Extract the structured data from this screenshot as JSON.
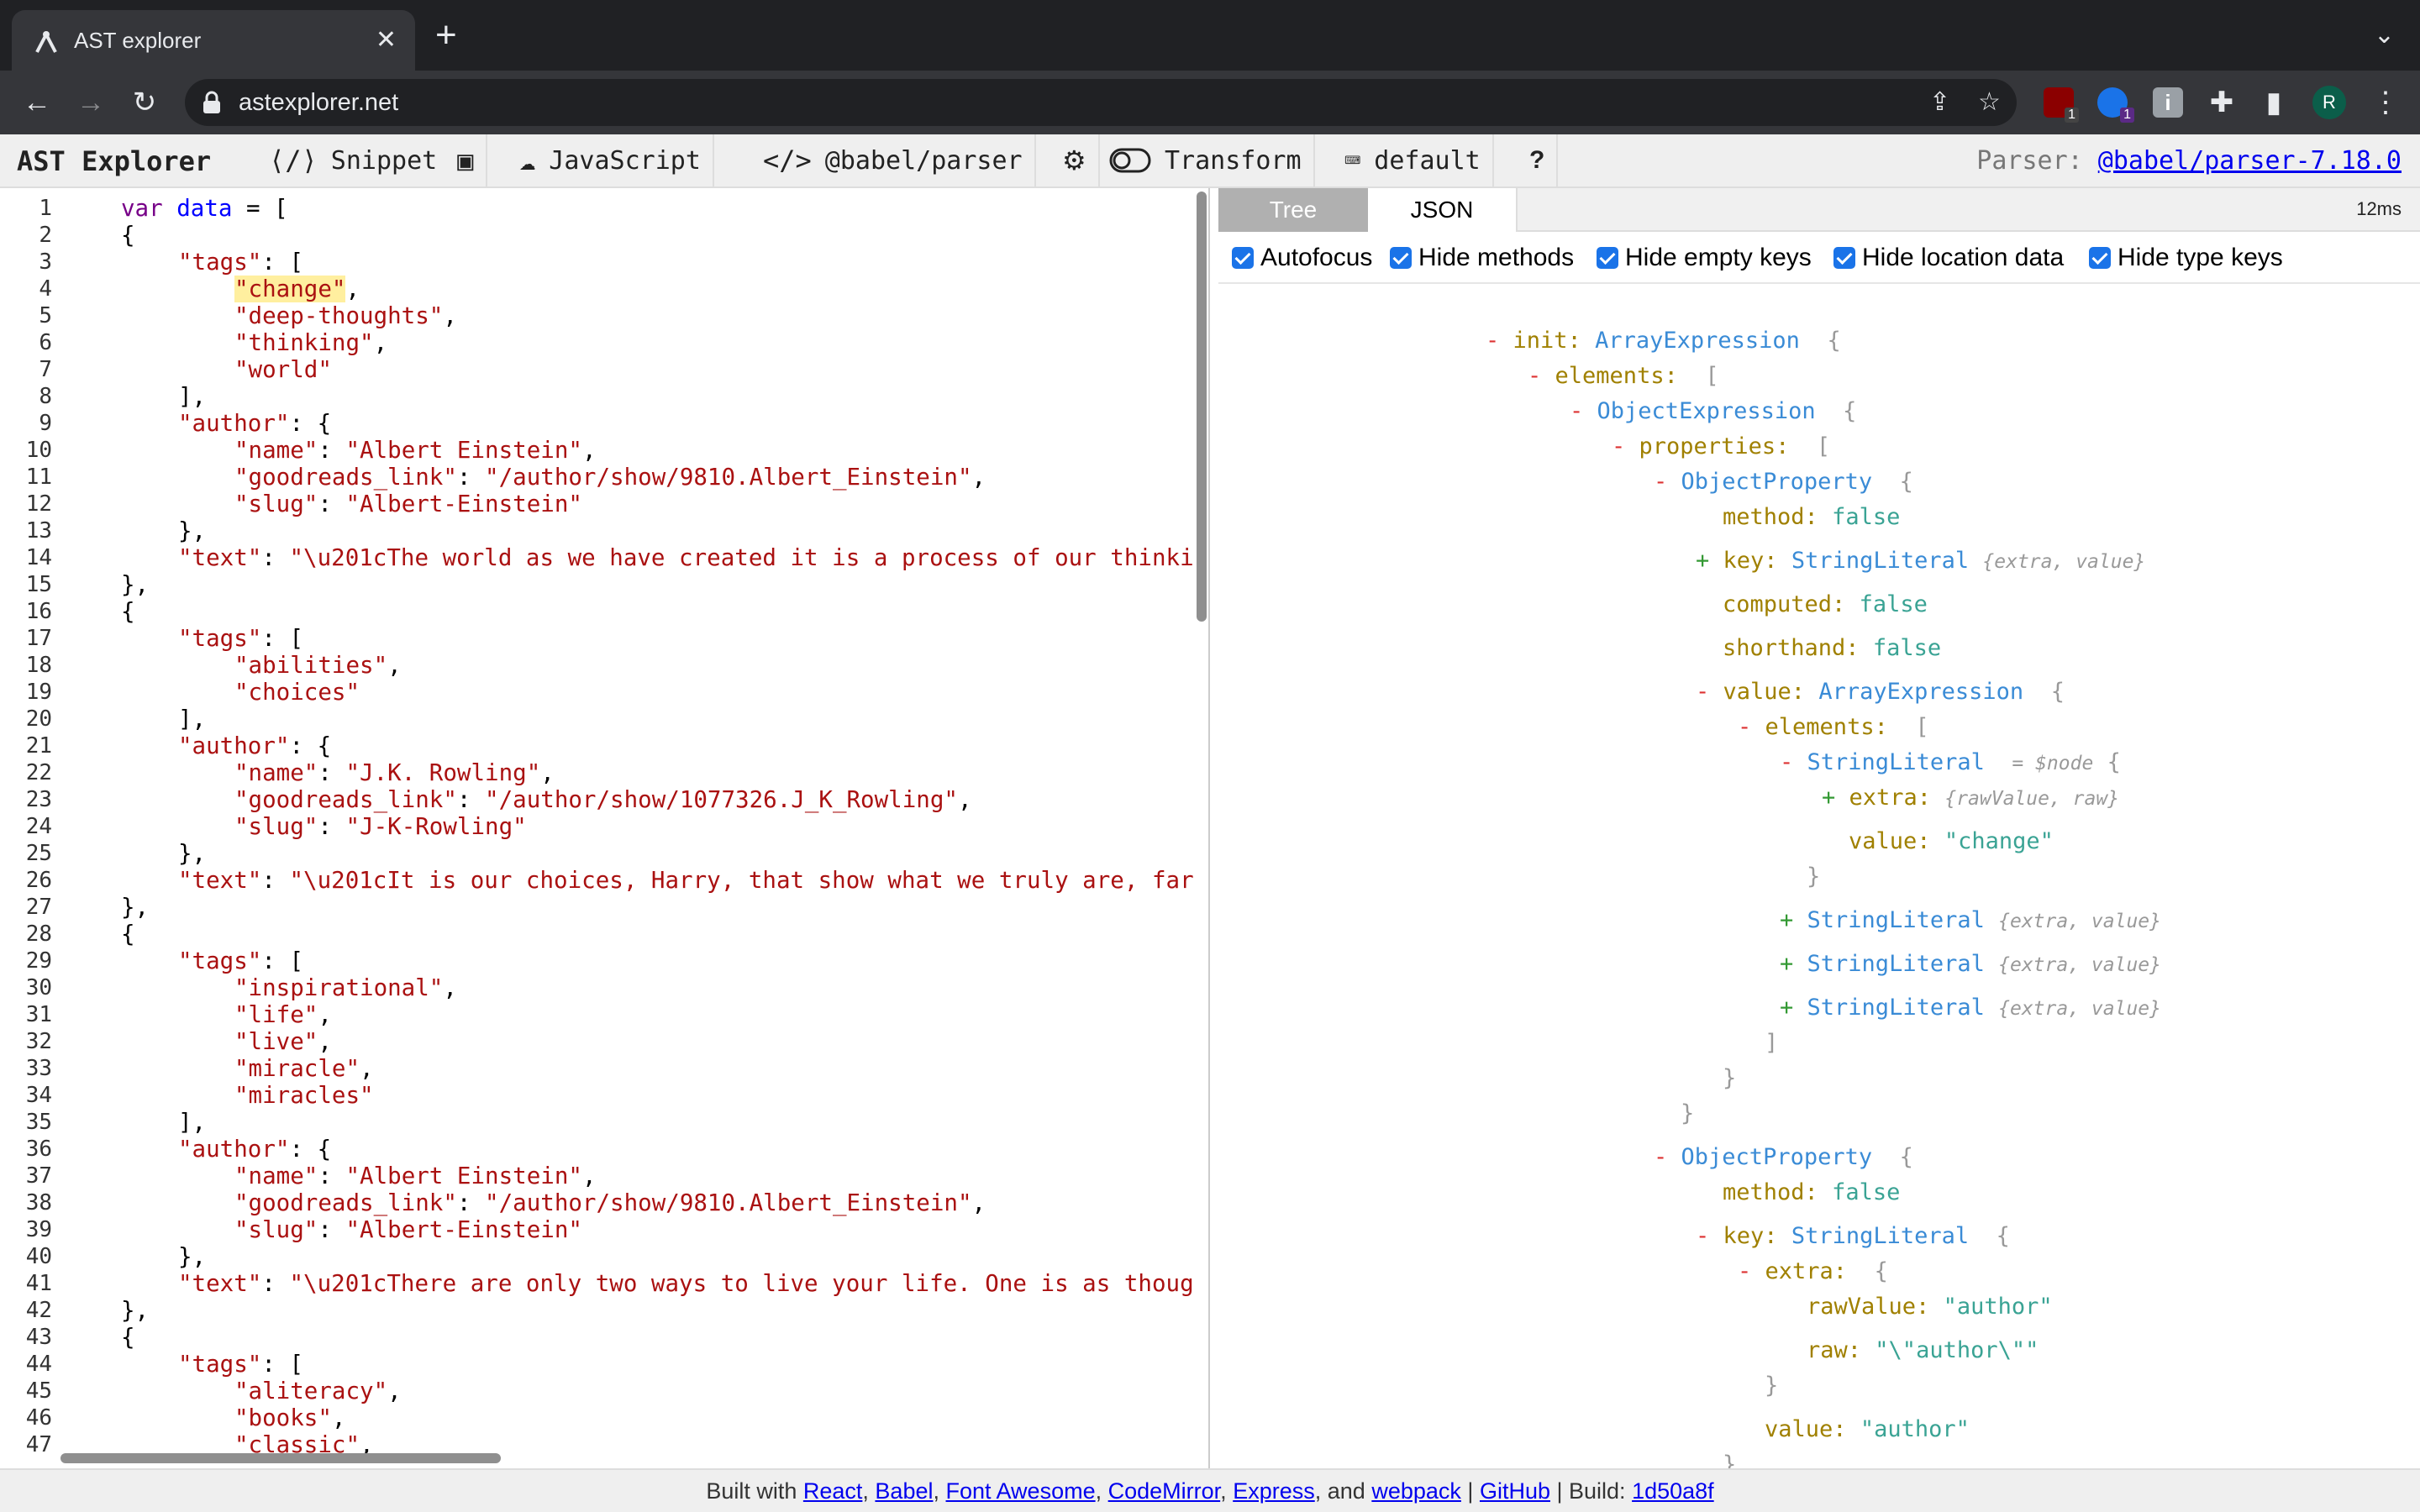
{
  "browser": {
    "tab_title": "AST explorer",
    "url": "astexplorer.net",
    "extension_badge_1": "1",
    "extension_badge_2": "1",
    "profile_initial": "R"
  },
  "header": {
    "brand": "AST Explorer",
    "snippet": "Snippet",
    "language": "JavaScript",
    "parser": "@babel/parser",
    "transform": "Transform",
    "keymap": "default",
    "help": "?",
    "parser_label": "Parser:",
    "parser_version": "@babel/parser-7.18.0"
  },
  "editor": {
    "line_numbers": [
      "1",
      "2",
      "3",
      "4",
      "5",
      "6",
      "7",
      "8",
      "9",
      "10",
      "11",
      "12",
      "13",
      "14",
      "15",
      "16",
      "17",
      "18",
      "19",
      "20",
      "21",
      "22",
      "23",
      "24",
      "25",
      "26",
      "27",
      "28",
      "29",
      "30",
      "31",
      "32",
      "33",
      "34",
      "35",
      "36",
      "37",
      "38",
      "39",
      "40",
      "41",
      "42",
      "43",
      "44",
      "45",
      "46",
      "47"
    ],
    "code": {
      "l1_kw": "var",
      "l1_var": "data",
      "l1_rest": " = [",
      "open_brace": "{",
      "close_obj": "},",
      "tags_key": "\"tags\"",
      "tags_open": ": [",
      "tags_close": "],",
      "author_key": "\"author\"",
      "author_open": ": {",
      "name_key": "\"name\"",
      "link_key": "\"goodreads_link\"",
      "slug_key": "\"slug\"",
      "text_key": "\"text\"",
      "sep": ": ",
      "comma": ",",
      "l4_tag": "\"change\"",
      "l5_tag": "\"deep-thoughts\"",
      "l6_tag": "\"thinking\"",
      "l7_tag": "\"world\"",
      "l10_name": "\"Albert Einstein\"",
      "l11_link": "\"/author/show/9810.Albert_Einstein\"",
      "l12_slug": "\"Albert-Einstein\"",
      "l14_text": "\"\\u201cThe world as we have created it is a process of our thinki",
      "l18_tag": "\"abilities\"",
      "l19_tag": "\"choices\"",
      "l22_name": "\"J.K. Rowling\"",
      "l23_link": "\"/author/show/1077326.J_K_Rowling\"",
      "l24_slug": "\"J-K-Rowling\"",
      "l26_text": "\"\\u201cIt is our choices, Harry, that show what we truly are, far",
      "l30_tag": "\"inspirational\"",
      "l31_tag": "\"life\"",
      "l32_tag": "\"live\"",
      "l33_tag": "\"miracle\"",
      "l34_tag": "\"miracles\"",
      "l37_name": "\"Albert Einstein\"",
      "l38_link": "\"/author/show/9810.Albert_Einstein\"",
      "l39_slug": "\"Albert-Einstein\"",
      "l41_text": "\"\\u201cThere are only two ways to live your life. One is as thoug",
      "l45_tag": "\"aliteracy\"",
      "l46_tag": "\"books\"",
      "l47_tag": "\"classic\""
    }
  },
  "output": {
    "tabs": [
      "Tree",
      "JSON"
    ],
    "timing": "12ms",
    "options": [
      "Autofocus",
      "Hide methods",
      "Hide empty keys",
      "Hide location data",
      "Hide type keys"
    ],
    "tree": {
      "minus": "-",
      "plus": "+",
      "brace_open": "{",
      "brace_close": "}",
      "bracket_open": "[",
      "bracket_close": "]",
      "init_key": "init:",
      "array_expression": "ArrayExpression",
      "elements_key": "elements:",
      "object_expression": "ObjectExpression",
      "properties_key": "properties:",
      "object_property": "ObjectProperty",
      "method_key": "method:",
      "false": "false",
      "key_key": "key:",
      "string_literal": "StringLiteral",
      "extra_value": "{extra, value}",
      "computed_key": "computed:",
      "shorthand_key": "shorthand:",
      "value_key": "value:",
      "node_ref": "= $node",
      "extra_key": "extra:",
      "raw_value_raw": "{rawValue, raw}",
      "value_change": "\"change\"",
      "raw_value_key": "rawValue:",
      "raw_value_author": "\"author\"",
      "raw_key": "raw:",
      "raw_author": "\"\\\"author\\\"\"",
      "value_author": "\"author\""
    }
  },
  "footer": {
    "built_with": "Built with ",
    "react": "React",
    "babel": "Babel",
    "font_awesome": "Font Awesome",
    "codemirror": "CodeMirror",
    "express": "Express",
    "and": "and",
    "webpack": "webpack",
    "github": "GitHub",
    "build_label": "Build:",
    "build_hash": "1d50a8f"
  },
  "colors": {
    "keyword": "#770088",
    "variable": "#0000ff",
    "string": "#aa1111",
    "tree_type": "#3a8bd6",
    "tree_key": "#a08000",
    "tree_value": "#3aa394",
    "accent": "#1a73e8"
  }
}
